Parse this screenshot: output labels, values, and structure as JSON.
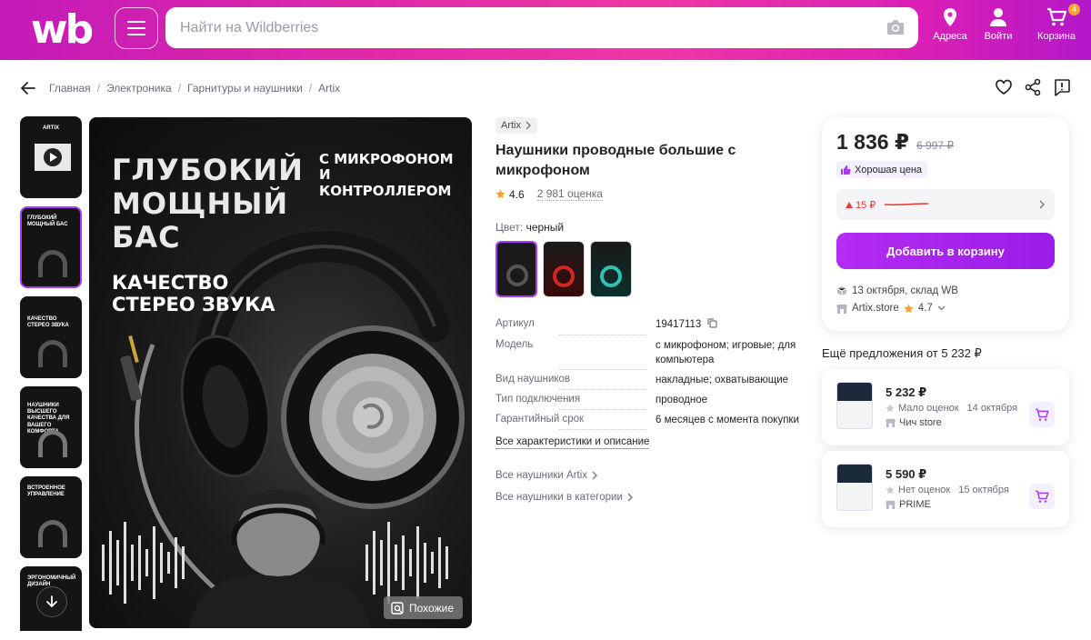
{
  "header": {
    "logo": "wb",
    "search_placeholder": "Найти на Wildberries",
    "nav": {
      "address": "Адреса",
      "login": "Войти",
      "cart": "Корзина",
      "cart_count": "4"
    }
  },
  "breadcrumbs": [
    "Главная",
    "Электроника",
    "Гарнитуры и наушники",
    "Artix"
  ],
  "thumbnails": {
    "t1": "artix",
    "t2": "глубокий мощный бас",
    "t3": "качество стерео звука",
    "t4": "наушники высшего качества для вашего комфорта",
    "t5": "встроенное управление",
    "t6": "эргономичный дизайн"
  },
  "hero": {
    "headline": "ГЛУБОКИЙ МОЩНЫЙ БАС",
    "sub": "С МИКРОФОНОМ И КОНТРОЛЛЕРОМ",
    "tagline": "КАЧЕСТВО СТЕРЕО ЗВУКА",
    "similar": "Похожие"
  },
  "product": {
    "brand": "Artix",
    "title": "Наушники проводные большие с микрофоном",
    "rating": "4.6",
    "reviews": "2 981 оценка",
    "color_label": "Цвет:",
    "color_value": "черный",
    "specs": [
      {
        "k": "Артикул",
        "v": "19417113"
      },
      {
        "k": "Модель",
        "v": "с микрофоном; игровые; для компьютера"
      },
      {
        "k": "Вид наушников",
        "v": "накладные; охватывающие"
      },
      {
        "k": "Тип подключения",
        "v": "проводное"
      },
      {
        "k": "Гарантийный срок",
        "v": "6 месяцев с момента покупки"
      }
    ],
    "all_specs": "Все характеристики и описание",
    "link_brand": "Все наушники Artix",
    "link_category": "Все наушники в категории"
  },
  "price_card": {
    "price": "1 836 ₽",
    "old_price": "6 997 ₽",
    "good_price": "Хорошая цена",
    "price_drop": "15 ₽",
    "add_to_cart": "Добавить в корзину",
    "delivery": "13 октября, склад WB",
    "seller": "Artix.store",
    "seller_rating": "4.7"
  },
  "more_offers": {
    "title": "Ещё предложения от 5 232 ₽",
    "offers": [
      {
        "price": "5 232 ₽",
        "reviews": "Мало оценок",
        "date": "14 октября",
        "seller": "Чич store"
      },
      {
        "price": "5 590 ₽",
        "reviews": "Нет оценок",
        "date": "15 октября",
        "seller": "PRIME"
      }
    ]
  },
  "colors": {
    "accent": "#a73afd",
    "header_pink": "#e02aa8",
    "price_drop": "#e53935",
    "star": "#f7a331"
  }
}
